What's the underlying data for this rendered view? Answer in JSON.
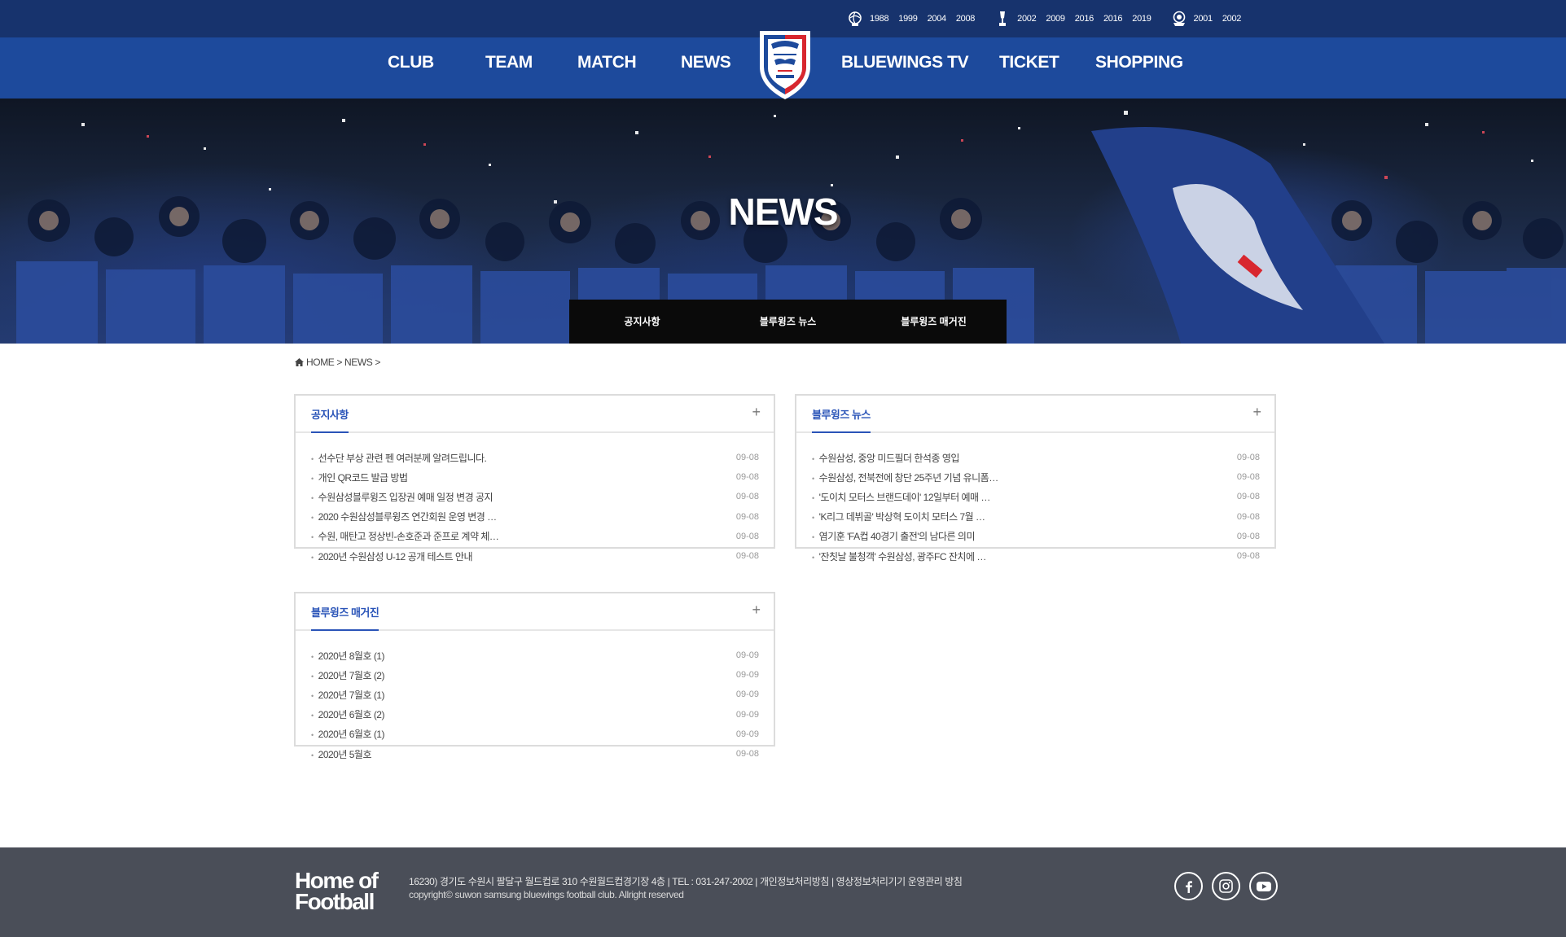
{
  "topbar": {
    "trophies": [
      {
        "icon": "globe-trophy-icon",
        "years": [
          "1988",
          "1999",
          "2004",
          "2008"
        ]
      },
      {
        "icon": "cup-trophy-icon",
        "years": [
          "2002",
          "2009",
          "2016",
          "2016",
          "2019"
        ]
      },
      {
        "icon": "asia-trophy-icon",
        "years": [
          "2001",
          "2002"
        ]
      }
    ]
  },
  "nav": {
    "items": [
      "CLUB",
      "TEAM",
      "MATCH",
      "NEWS",
      "BLUEWINGS TV",
      "TICKET",
      "SHOPPING"
    ]
  },
  "hero": {
    "title": "NEWS",
    "subnav": [
      "공지사항",
      "블루윙즈 뉴스",
      "블루윙즈 매거진"
    ]
  },
  "breadcrumb": {
    "home": "HOME",
    "current": "NEWS"
  },
  "boards": [
    {
      "title": "공지사항",
      "plus": "+",
      "items": [
        {
          "text": "선수단 부상 관련 펜 여러분께 알려드립니다.",
          "date": "09-08"
        },
        {
          "text": "개인 QR코드 발급 방법",
          "date": "09-08"
        },
        {
          "text": "수원삼성블루윙즈 입장권 예매 일정 변경 공지",
          "date": "09-08"
        },
        {
          "text": "2020 수원삼성블루윙즈 연간회원 운영 변경 …",
          "date": "09-08"
        },
        {
          "text": "수원, 매탄고 정상빈-손호준과 준프로 계약 체…",
          "date": "09-08"
        },
        {
          "text": "2020년 수원삼성 U-12 공개 테스트 안내",
          "date": "09-08"
        }
      ]
    },
    {
      "title": "블루윙즈 뉴스",
      "plus": "+",
      "items": [
        {
          "text": "수원삼성, 중앙 미드필더 한석종 영입",
          "date": "09-08"
        },
        {
          "text": "수원삼성, 전북전에 창단 25주년 기념 유니폼…",
          "date": "09-08"
        },
        {
          "text": "'도이치 모터스 브랜드데이' 12일부터 예매 …",
          "date": "09-08"
        },
        {
          "text": "'K리그 데뷔골' 박상혁 도이치 모터스 7월 …",
          "date": "09-08"
        },
        {
          "text": "염기훈 'FA컵 40경기 출전'의 남다른 의미",
          "date": "09-08"
        },
        {
          "text": "'잔칫날 불청객' 수원삼성, 광주FC 잔치에 …",
          "date": "09-08"
        }
      ]
    },
    {
      "title": "블루윙즈 매거진",
      "plus": "+",
      "items": [
        {
          "text": "2020년 8월호 (1)",
          "date": "09-09"
        },
        {
          "text": "2020년 7월호 (2)",
          "date": "09-09"
        },
        {
          "text": "2020년 7월호 (1)",
          "date": "09-09"
        },
        {
          "text": "2020년 6월호 (2)",
          "date": "09-09"
        },
        {
          "text": "2020년 6월호 (1)",
          "date": "09-09"
        },
        {
          "text": "2020년 5월호",
          "date": "09-08"
        }
      ]
    }
  ],
  "footer": {
    "logo_line1": "Home of",
    "logo_line2": "Football",
    "address": "16230) 경기도 수원시 팔달구 월드컵로 310 수원월드컵경기장 4층 | TEL : 031-247-2002 | 개인정보처리방침 | 영상정보처리기기 운영관리 방침",
    "copyright": "copyright© suwon samsung bluewings football club. Allright reserved",
    "social": [
      "facebook-icon",
      "instagram-icon",
      "youtube-icon"
    ]
  },
  "colors": {
    "topbar": "#17336d",
    "nav": "#1d4a9c",
    "accent": "#2a54b8",
    "footer": "#4a4e58",
    "subnav": "#0a0a0a"
  }
}
